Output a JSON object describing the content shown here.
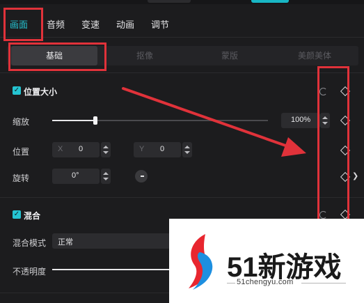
{
  "tabs": [
    "画面",
    "音频",
    "变速",
    "动画",
    "调节"
  ],
  "active_tab": "画面",
  "subtabs": [
    "基础",
    "抠像",
    "蒙版",
    "美颜美体"
  ],
  "active_subtab": "基础",
  "position_size": {
    "title": "位置大小",
    "scale": {
      "label": "缩放",
      "value": "100%",
      "level_percent": 26
    },
    "position": {
      "label": "位置",
      "x_axis": "X",
      "x_value": "0",
      "y_axis": "Y",
      "y_value": "0"
    },
    "rotation": {
      "label": "旋转",
      "value": "0°"
    }
  },
  "blend": {
    "title": "混合",
    "mode_label": "混合模式",
    "mode_value": "正常",
    "opacity_label": "不透明度"
  },
  "watermark": {
    "brand": "51新游戏",
    "url": "51chengyu.com"
  },
  "colors": {
    "accent": "#25c4d2",
    "annotation_red": "#e0323a",
    "panel_bg": "#1c1c1e"
  },
  "icons": [
    "reset-icon",
    "keyframe-diamond-icon",
    "chevron-right-icon",
    "checkbox-checked-icon",
    "stepper-icon",
    "rotation-knob-icon"
  ]
}
